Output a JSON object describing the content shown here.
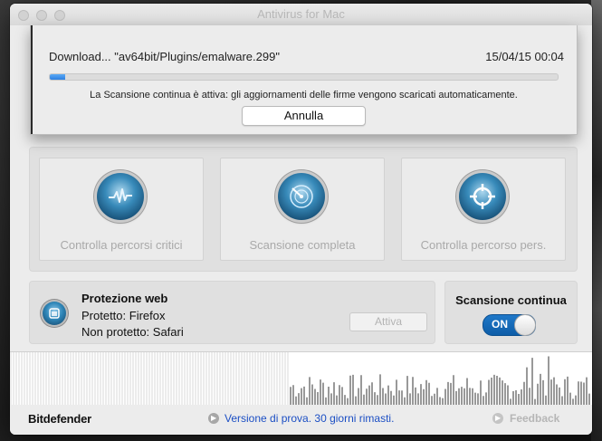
{
  "window": {
    "title": "Antivirus for Mac"
  },
  "download": {
    "text": "Download... \"av64bit/Plugins/emalware.299\"",
    "date": "15/04/15 00:04",
    "progress": 0.03,
    "info": "La Scansione continua è attiva: gli aggiornamenti delle firme vengono scaricati automaticamente.",
    "cancel_label": "Annulla"
  },
  "scans": [
    {
      "label": "Controlla percorsi critici",
      "icon": "heartbeat-icon"
    },
    {
      "label": "Scansione completa",
      "icon": "radar-icon"
    },
    {
      "label": "Controlla percorso pers.",
      "icon": "target-icon"
    }
  ],
  "web_protection": {
    "title": "Protezione web",
    "protected": "Protetto: Firefox",
    "unprotected": "Non protetto: Safari",
    "activate_label": "Attiva",
    "icon": "browser-shield-icon"
  },
  "continuous_scan": {
    "title": "Scansione continua",
    "toggle_label": "ON",
    "state": true
  },
  "footer": {
    "brand": "Bitdefender",
    "trial_text": "Versione di prova. 30 giorni rimasti.",
    "feedback_label": "Feedback"
  },
  "colors": {
    "accent": "#1f78c8",
    "link": "#1c4fc4",
    "window_bg": "#ececec"
  }
}
